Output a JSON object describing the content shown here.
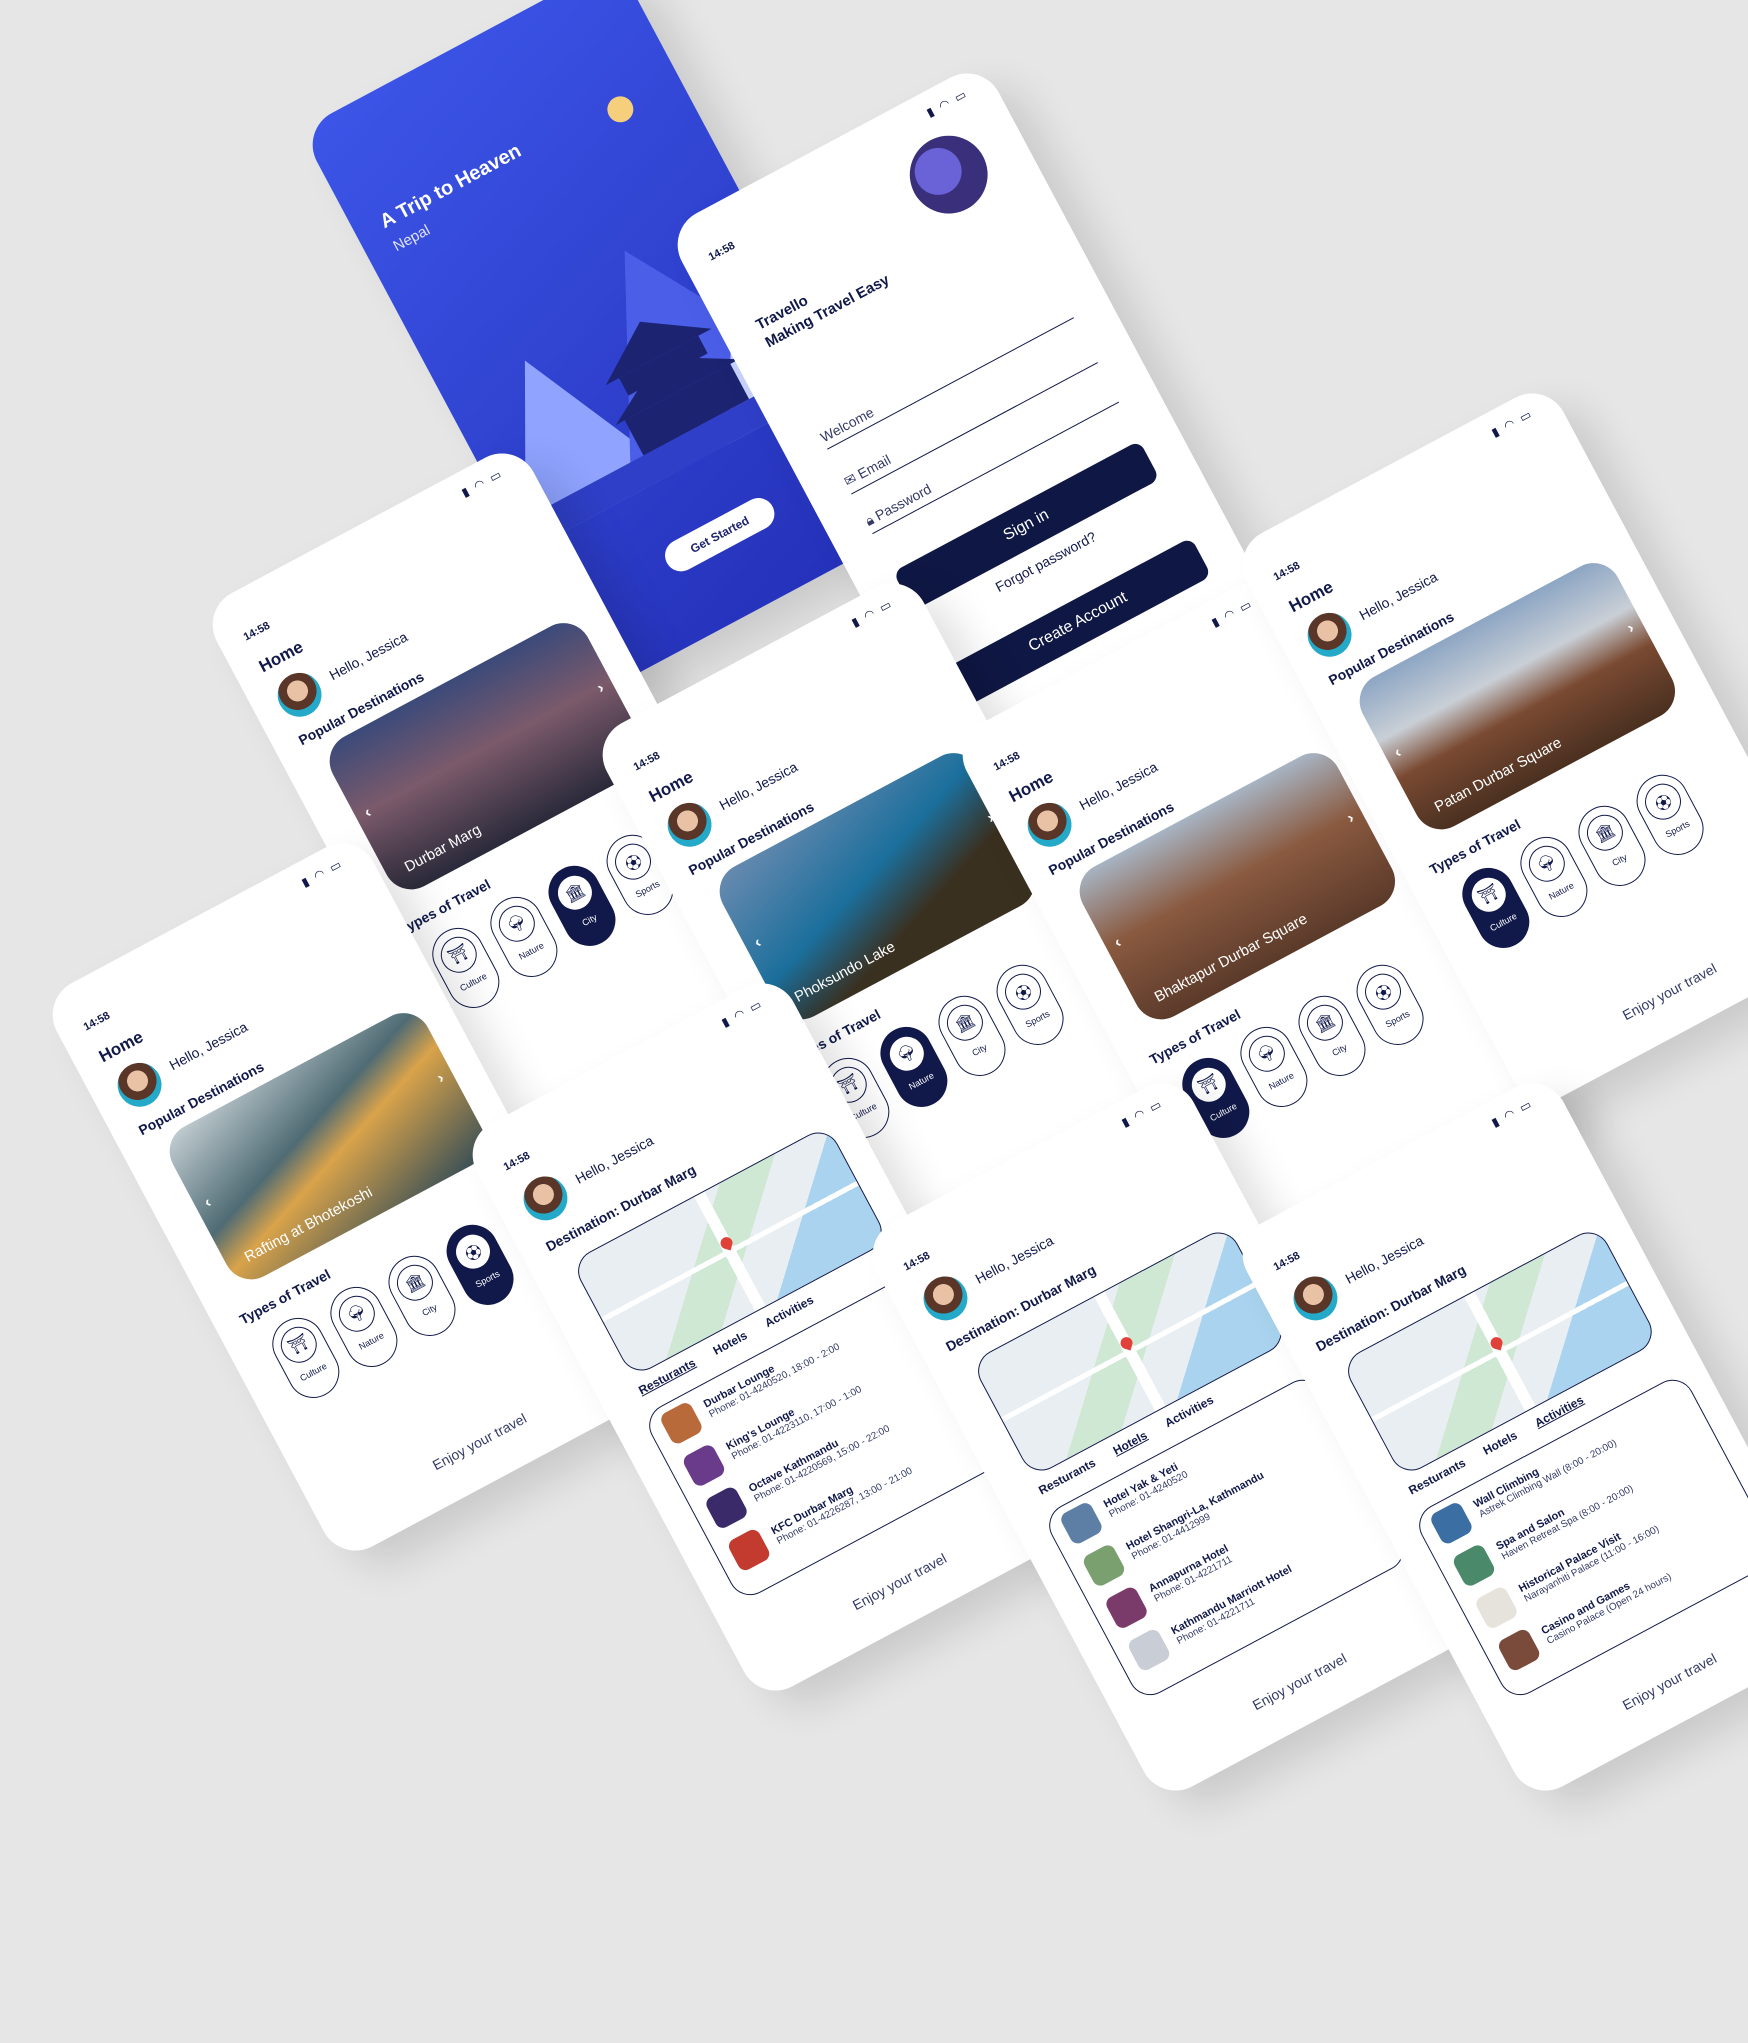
{
  "common": {
    "status_icons": "▮ ◠ ▭",
    "time": "14:58",
    "home": "Home",
    "hello": "Hello, Jessica",
    "popular": "Popular Destinations",
    "types_title": "Types of Travel",
    "enjoy": "Enjoy your travel",
    "arrow_left": "‹",
    "arrow_right": "›",
    "types": [
      {
        "label": "Culture",
        "icon": "temple-icon"
      },
      {
        "label": "Nature",
        "icon": "tree-icon"
      },
      {
        "label": "City",
        "icon": "buildings-icon"
      },
      {
        "label": "Sports",
        "icon": "sports-icon"
      }
    ]
  },
  "splash": {
    "title": "A Trip to Heaven",
    "subtitle": "Nepal",
    "button": "Get Started"
  },
  "login": {
    "brand": "Travello",
    "tagline": "Making Travel Easy",
    "welcome": "Welcome",
    "email_placeholder": "Email",
    "password_placeholder": "Password",
    "signin": "Sign in",
    "forgot": "Forgot password?",
    "create": "Create Account"
  },
  "home_screens": [
    {
      "caption": "Durbar Marg",
      "active_type": "City"
    },
    {
      "caption": "Phoksundo Lake",
      "active_type": "Nature"
    },
    {
      "caption": "Bhaktapur Durbar Square",
      "active_type": "Culture"
    },
    {
      "caption": "Patan Durbar Square",
      "active_type": "Culture"
    },
    {
      "caption": "Rafting at Bhotekoshi",
      "active_type": "Sports"
    }
  ],
  "destination": {
    "title": "Destination: Durbar Marg",
    "tabs": [
      "Resturants",
      "Hotels",
      "Activities"
    ],
    "restaurants": [
      {
        "name": "Durbar Lounge",
        "info": "Phone: 01-4240520, 18:00 - 2:00"
      },
      {
        "name": "King's Lounge",
        "info": "Phone: 01-4223110, 17:00 - 1:00"
      },
      {
        "name": "Octave Kathmandu",
        "info": "Phone: 01-4220569, 15:00 - 22:00"
      },
      {
        "name": "KFC Durbar Marg",
        "info": "Phone: 01-4226287, 13:00 - 21:00"
      }
    ],
    "hotels": [
      {
        "name": "Hotel Yak & Yeti",
        "info": "Phone: 01-4240520"
      },
      {
        "name": "Hotel Shangri-La, Kathmandu",
        "info": "Phone: 01-4412999"
      },
      {
        "name": "Annapurna Hotel",
        "info": "Phone: 01-4221711"
      },
      {
        "name": "Kathmandu Marriott Hotel",
        "info": "Phone: 01-4221711"
      }
    ],
    "activities": [
      {
        "name": "Wall Climbing",
        "info": "Astrek Climbing Wall (8:00 - 20:00)"
      },
      {
        "name": "Spa and Salon",
        "info": "Haven Retreat Spa (8:00 - 20:00)"
      },
      {
        "name": "Historical Palace Visit",
        "info": "Narayanhiti Palace (11:00 - 16:00)"
      },
      {
        "name": "Casino and Games",
        "info": "Casino Palace (Open 24 hours)"
      }
    ]
  }
}
